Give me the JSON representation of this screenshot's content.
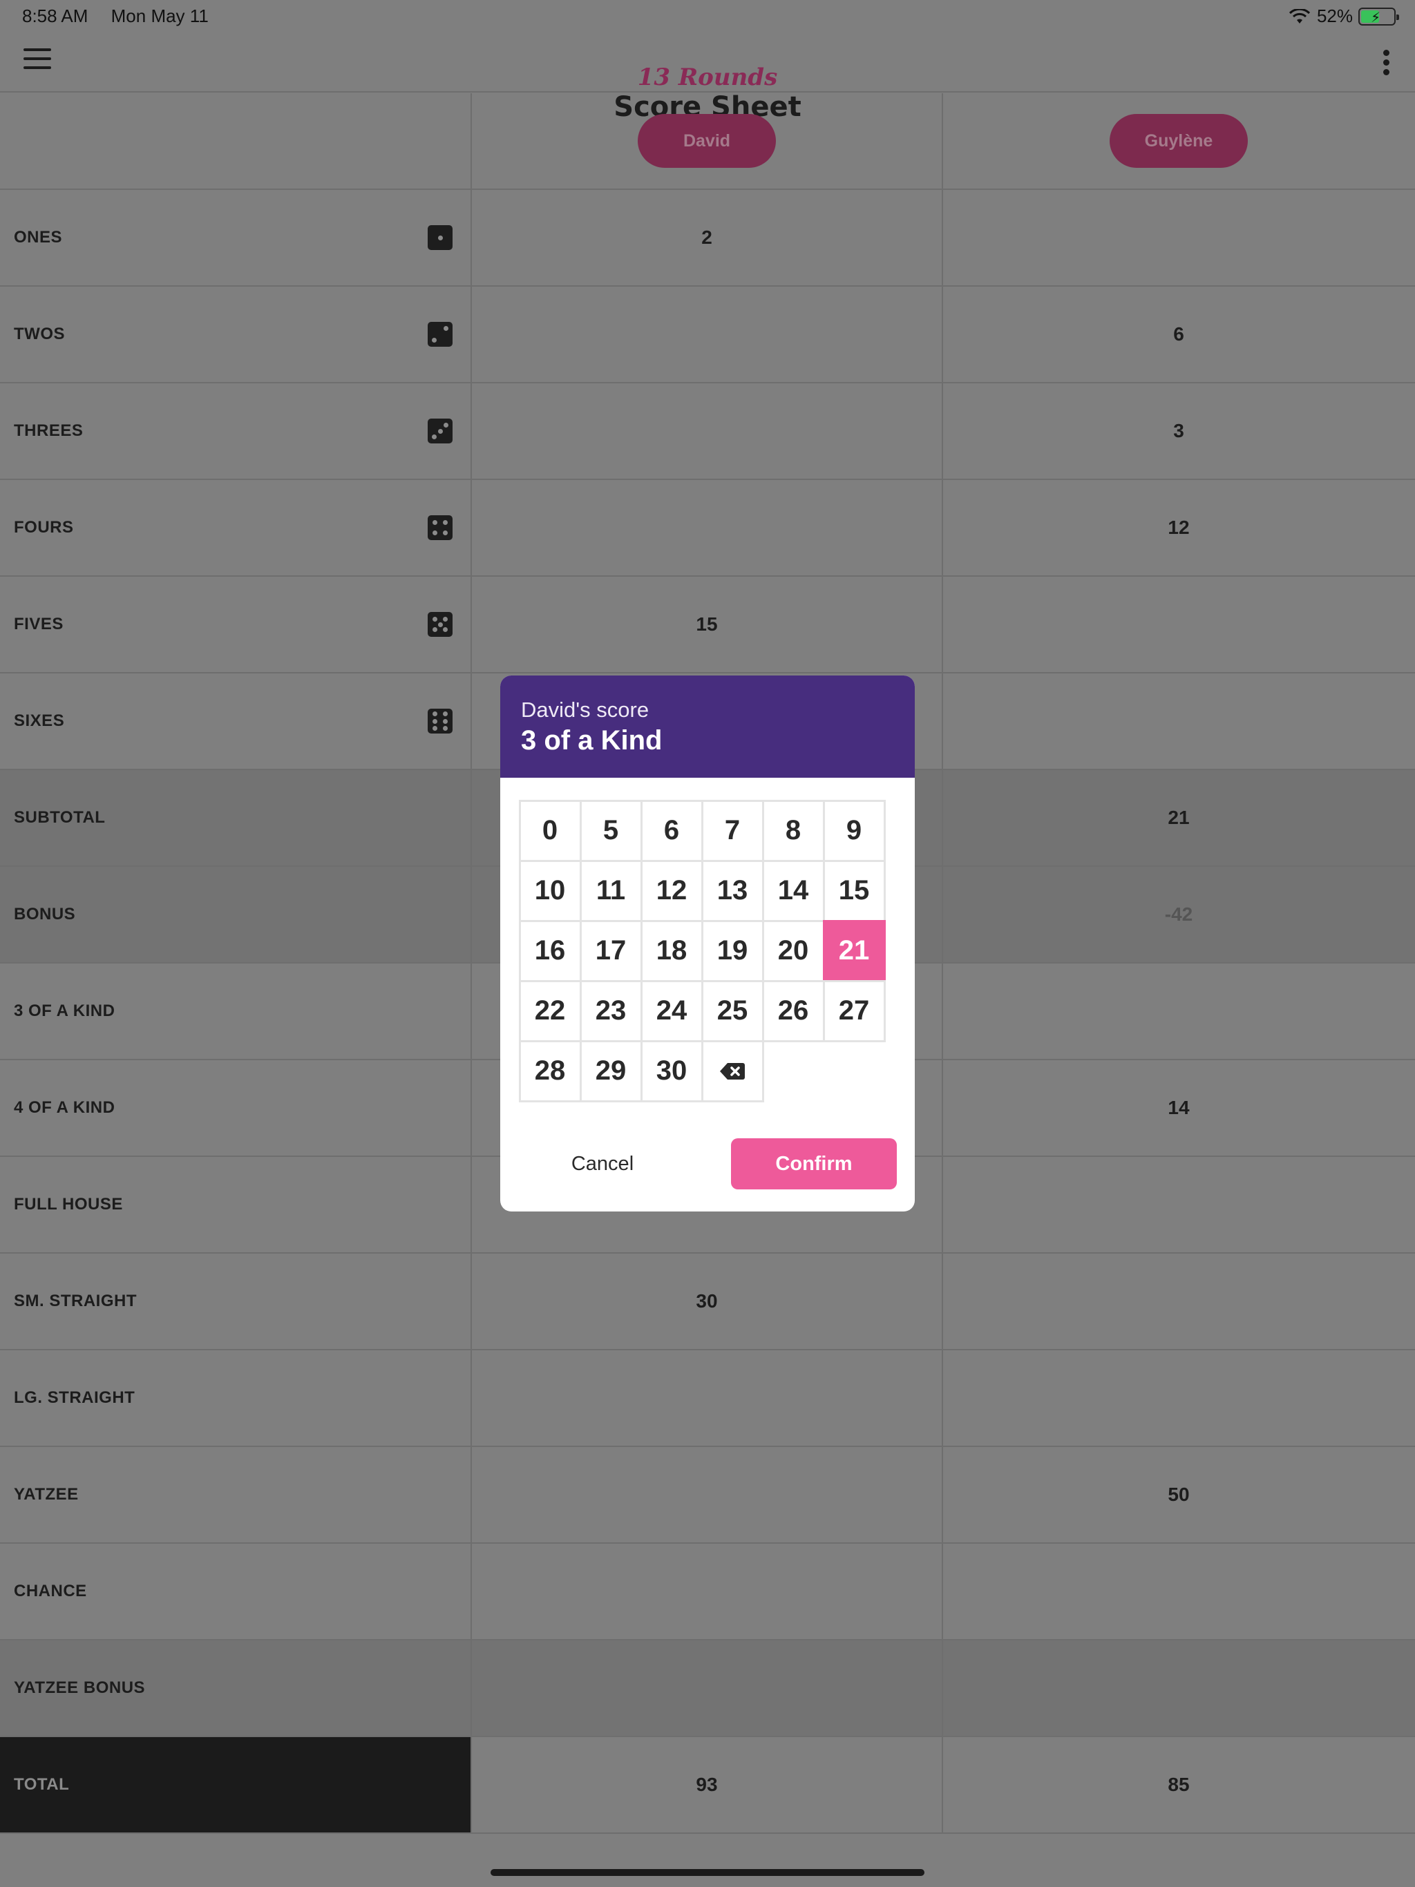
{
  "status": {
    "time": "8:58 AM",
    "date": "Mon May 11",
    "battery": "52%"
  },
  "header": {
    "subtitle": "13 Rounds",
    "title": "Score Sheet"
  },
  "players": [
    "David",
    "Guylène"
  ],
  "rows": [
    {
      "label": "ONES",
      "die": 1,
      "scores": [
        "2",
        ""
      ]
    },
    {
      "label": "TWOS",
      "die": 2,
      "scores": [
        "",
        "6"
      ]
    },
    {
      "label": "THREES",
      "die": 3,
      "scores": [
        "",
        "3"
      ]
    },
    {
      "label": "FOURS",
      "die": 4,
      "scores": [
        "",
        "12"
      ]
    },
    {
      "label": "FIVES",
      "die": 5,
      "scores": [
        "15",
        ""
      ]
    },
    {
      "label": "SIXES",
      "die": 6,
      "scores": [
        "",
        ""
      ]
    },
    {
      "label": "SUBTOTAL",
      "scores": [
        "",
        "21"
      ]
    },
    {
      "label": "BONUS",
      "scores": [
        "",
        "-42"
      ]
    },
    {
      "label": "3 OF A KIND",
      "scores": [
        "",
        ""
      ]
    },
    {
      "label": "4 OF A KIND",
      "scores": [
        "",
        "14"
      ]
    },
    {
      "label": "FULL HOUSE",
      "scores": [
        "",
        ""
      ]
    },
    {
      "label": "SM. STRAIGHT",
      "scores": [
        "30",
        ""
      ]
    },
    {
      "label": "LG. STRAIGHT",
      "scores": [
        "",
        ""
      ]
    },
    {
      "label": "YATZEE",
      "scores": [
        "",
        "50"
      ]
    },
    {
      "label": "CHANCE",
      "scores": [
        "",
        ""
      ]
    },
    {
      "label": "YATZEE BONUS",
      "scores": [
        "",
        ""
      ]
    },
    {
      "label": "TOTAL",
      "scores": [
        "93",
        "85"
      ]
    }
  ],
  "dialog": {
    "subtitle": "David's score",
    "title": "3 of a Kind",
    "keys": [
      [
        "0",
        "5",
        "6",
        "7",
        "8",
        "9"
      ],
      [
        "10",
        "11",
        "12",
        "13",
        "14",
        "15"
      ],
      [
        "16",
        "17",
        "18",
        "19",
        "20",
        "21"
      ],
      [
        "22",
        "23",
        "24",
        "25",
        "26",
        "27"
      ],
      [
        "28",
        "29",
        "30"
      ]
    ],
    "selected": "21",
    "cancel_label": "Cancel",
    "confirm_label": "Confirm"
  }
}
